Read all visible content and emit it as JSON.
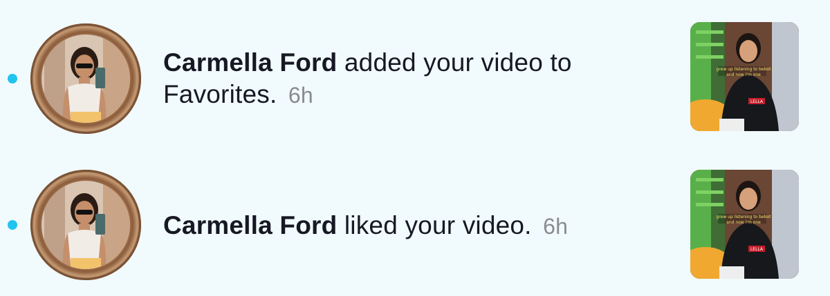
{
  "notifications": [
    {
      "username": "Carmella Ford",
      "action": "added your video to Favorites.",
      "time": "6h",
      "unread": true,
      "avatar_icon": "user-avatar-photo",
      "thumbnail_icon": "video-thumbnail"
    },
    {
      "username": "Carmella Ford",
      "action": "liked your video.",
      "time": "6h",
      "unread": true,
      "avatar_icon": "user-avatar-photo",
      "thumbnail_icon": "video-thumbnail"
    }
  ],
  "colors": {
    "background": "#f1fafc",
    "unread_dot": "#20c4ee",
    "text": "#161823",
    "time": "#8a8b91"
  }
}
